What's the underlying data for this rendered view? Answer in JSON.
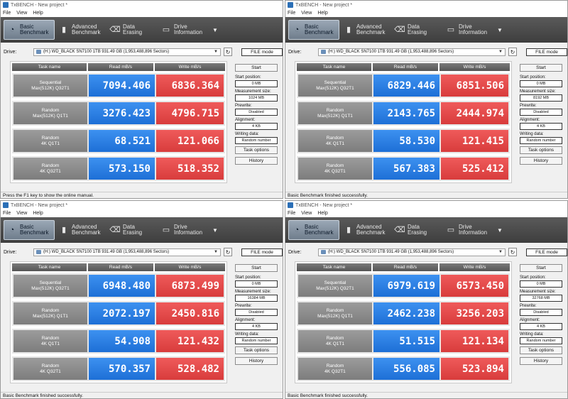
{
  "windows": [
    {
      "title": "TxBENCH - New project *",
      "menu": [
        "File",
        "View",
        "Help"
      ],
      "tabs": [
        {
          "label": "Basic Benchmark",
          "icon": "gauge-icon"
        },
        {
          "label": "Advanced Benchmark",
          "icon": "bar-chart-icon"
        },
        {
          "label": "Data Erasing",
          "icon": "eraser-icon"
        },
        {
          "label": "Drive Information",
          "icon": "drive-icon"
        }
      ],
      "drive_label": "Drive:",
      "drive_value": "(H:) WD_BLACK SN7100 1TB  931.49 GB (1,953,488,896 Sectors)",
      "file_mode": "FILE mode",
      "headers": [
        "Task name",
        "Read mB/s",
        "Write mB/s"
      ],
      "rows": [
        {
          "task1": "Sequential",
          "task2": "Max(512K) Q32T1",
          "read": "7094.406",
          "write": "6836.364"
        },
        {
          "task1": "Random",
          "task2": "Max(512K) Q1T1",
          "read": "3276.423",
          "write": "4796.715"
        },
        {
          "task1": "Random",
          "task2": "4K Q1T1",
          "read": "68.521",
          "write": "121.066"
        },
        {
          "task1": "Random",
          "task2": "4K Q32T1",
          "read": "573.150",
          "write": "518.352"
        }
      ],
      "side": {
        "start": "Start",
        "start_pos_label": "Start position:",
        "start_pos": "0 MB",
        "meas_label": "Measurement size:",
        "meas": "1024 MB",
        "prewrite_label": "Prewrite:",
        "prewrite": "Disabled",
        "align_label": "Alignment:",
        "align": "4 KB",
        "writing_label": "Writing data:",
        "writing": "Random number",
        "task_options": "Task options",
        "history": "History"
      },
      "status": "Press the F1 key to show the online manual."
    },
    {
      "title": "TxBENCH - New project *",
      "menu": [
        "File",
        "View",
        "Help"
      ],
      "tabs": [
        {
          "label": "Basic Benchmark",
          "icon": "gauge-icon"
        },
        {
          "label": "Advanced Benchmark",
          "icon": "bar-chart-icon"
        },
        {
          "label": "Data Erasing",
          "icon": "eraser-icon"
        },
        {
          "label": "Drive Information",
          "icon": "drive-icon"
        }
      ],
      "drive_label": "Drive:",
      "drive_value": "(H:) WD_BLACK SN7100 1TB  931.49 GB (1,953,488,896 Sectors)",
      "file_mode": "FILE mode",
      "headers": [
        "Task name",
        "Read mB/s",
        "Write mB/s"
      ],
      "rows": [
        {
          "task1": "Sequential",
          "task2": "Max(512K) Q32T1",
          "read": "6829.446",
          "write": "6851.506"
        },
        {
          "task1": "Random",
          "task2": "Max(512K) Q1T1",
          "read": "2143.765",
          "write": "2444.974"
        },
        {
          "task1": "Random",
          "task2": "4K Q1T1",
          "read": "58.530",
          "write": "121.415"
        },
        {
          "task1": "Random",
          "task2": "4K Q32T1",
          "read": "567.383",
          "write": "525.412"
        }
      ],
      "side": {
        "start": "Start",
        "start_pos_label": "Start position:",
        "start_pos": "0 MB",
        "meas_label": "Measurement size:",
        "meas": "8192 MB",
        "prewrite_label": "Prewrite:",
        "prewrite": "Disabled",
        "align_label": "Alignment:",
        "align": "4 KB",
        "writing_label": "Writing data:",
        "writing": "Random number",
        "task_options": "Task options",
        "history": "History"
      },
      "status": "Basic Benchmark finished successfully."
    },
    {
      "title": "TxBENCH - New project *",
      "menu": [
        "File",
        "View",
        "Help"
      ],
      "tabs": [
        {
          "label": "Basic Benchmark",
          "icon": "gauge-icon"
        },
        {
          "label": "Advanced Benchmark",
          "icon": "bar-chart-icon"
        },
        {
          "label": "Data Erasing",
          "icon": "eraser-icon"
        },
        {
          "label": "Drive Information",
          "icon": "drive-icon"
        }
      ],
      "drive_label": "Drive:",
      "drive_value": "(H:) WD_BLACK SN7100 1TB  931.49 GB (1,953,488,896 Sectors)",
      "file_mode": "FILE mode",
      "headers": [
        "Task name",
        "Read mB/s",
        "Write mB/s"
      ],
      "rows": [
        {
          "task1": "Sequential",
          "task2": "Max(512K) Q32T1",
          "read": "6948.480",
          "write": "6873.499"
        },
        {
          "task1": "Random",
          "task2": "Max(512K) Q1T1",
          "read": "2072.197",
          "write": "2450.816"
        },
        {
          "task1": "Random",
          "task2": "4K Q1T1",
          "read": "54.908",
          "write": "121.432"
        },
        {
          "task1": "Random",
          "task2": "4K Q32T1",
          "read": "570.357",
          "write": "528.482"
        }
      ],
      "side": {
        "start": "Start",
        "start_pos_label": "Start position:",
        "start_pos": "0 MB",
        "meas_label": "Measurement size:",
        "meas": "16384 MB",
        "prewrite_label": "Prewrite:",
        "prewrite": "Disabled",
        "align_label": "Alignment:",
        "align": "4 KB",
        "writing_label": "Writing data:",
        "writing": "Random number",
        "task_options": "Task options",
        "history": "History"
      },
      "status": "Basic Benchmark finished successfully."
    },
    {
      "title": "TxBENCH - New project *",
      "menu": [
        "File",
        "View",
        "Help"
      ],
      "tabs": [
        {
          "label": "Basic Benchmark",
          "icon": "gauge-icon"
        },
        {
          "label": "Advanced Benchmark",
          "icon": "bar-chart-icon"
        },
        {
          "label": "Data Erasing",
          "icon": "eraser-icon"
        },
        {
          "label": "Drive Information",
          "icon": "drive-icon"
        }
      ],
      "drive_label": "Drive:",
      "drive_value": "(H:) WD_BLACK SN7100 1TB  931.49 GB (1,953,488,896 Sectors)",
      "file_mode": "FILE mode",
      "headers": [
        "Task name",
        "Read mB/s",
        "Write mB/s"
      ],
      "rows": [
        {
          "task1": "Sequential",
          "task2": "Max(512K) Q32T1",
          "read": "6979.619",
          "write": "6573.450"
        },
        {
          "task1": "Random",
          "task2": "Max(512K) Q1T1",
          "read": "2462.238",
          "write": "3256.203"
        },
        {
          "task1": "Random",
          "task2": "4K Q1T1",
          "read": "51.515",
          "write": "121.134"
        },
        {
          "task1": "Random",
          "task2": "4K Q32T1",
          "read": "556.085",
          "write": "523.894"
        }
      ],
      "side": {
        "start": "Start",
        "start_pos_label": "Start position:",
        "start_pos": "0 MB",
        "meas_label": "Measurement size:",
        "meas": "32768 MB",
        "prewrite_label": "Prewrite:",
        "prewrite": "Disabled",
        "align_label": "Alignment:",
        "align": "4 KB",
        "writing_label": "Writing data:",
        "writing": "Random number",
        "task_options": "Task options",
        "history": "History"
      },
      "status": "Basic Benchmark finished successfully."
    }
  ]
}
